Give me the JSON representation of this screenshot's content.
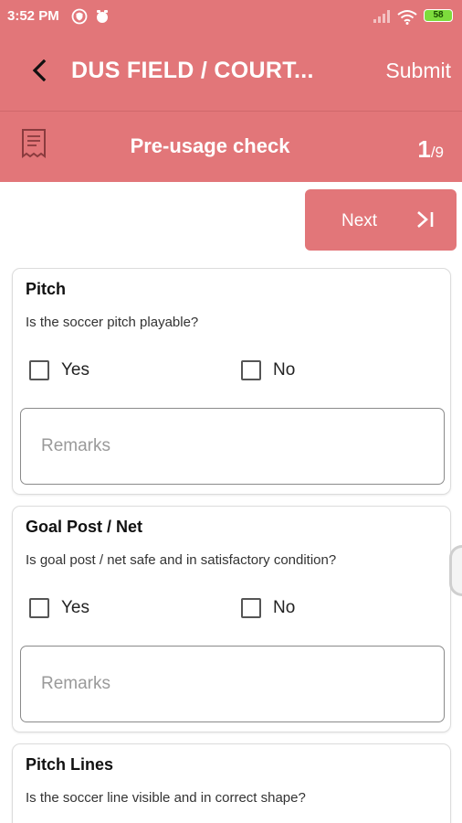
{
  "status_bar": {
    "time": "3:52 PM",
    "battery": "58"
  },
  "header": {
    "title": "DUS FIELD / COURT...",
    "submit_label": "Submit"
  },
  "subheader": {
    "title": "Pre-usage check",
    "page_current": "1",
    "page_total": "/9"
  },
  "nav": {
    "next_label": "Next"
  },
  "cards": [
    {
      "title": "Pitch",
      "question": "Is the soccer pitch playable?",
      "yes_label": "Yes",
      "no_label": "No",
      "remarks_placeholder": "Remarks"
    },
    {
      "title": "Goal Post / Net",
      "question": "Is goal post / net safe and in satisfactory condition?",
      "yes_label": "Yes",
      "no_label": "No",
      "remarks_placeholder": "Remarks"
    },
    {
      "title": "Pitch Lines",
      "question": "Is the soccer line visible and in correct shape?"
    }
  ],
  "colors": {
    "accent": "#e27679",
    "battery": "#7ddc3c"
  },
  "icons": [
    "back-arrow-icon",
    "receipt-icon",
    "skip-next-icon",
    "signal-icon",
    "wifi-icon",
    "battery-icon",
    "shield-icon",
    "alarm-icon"
  ]
}
